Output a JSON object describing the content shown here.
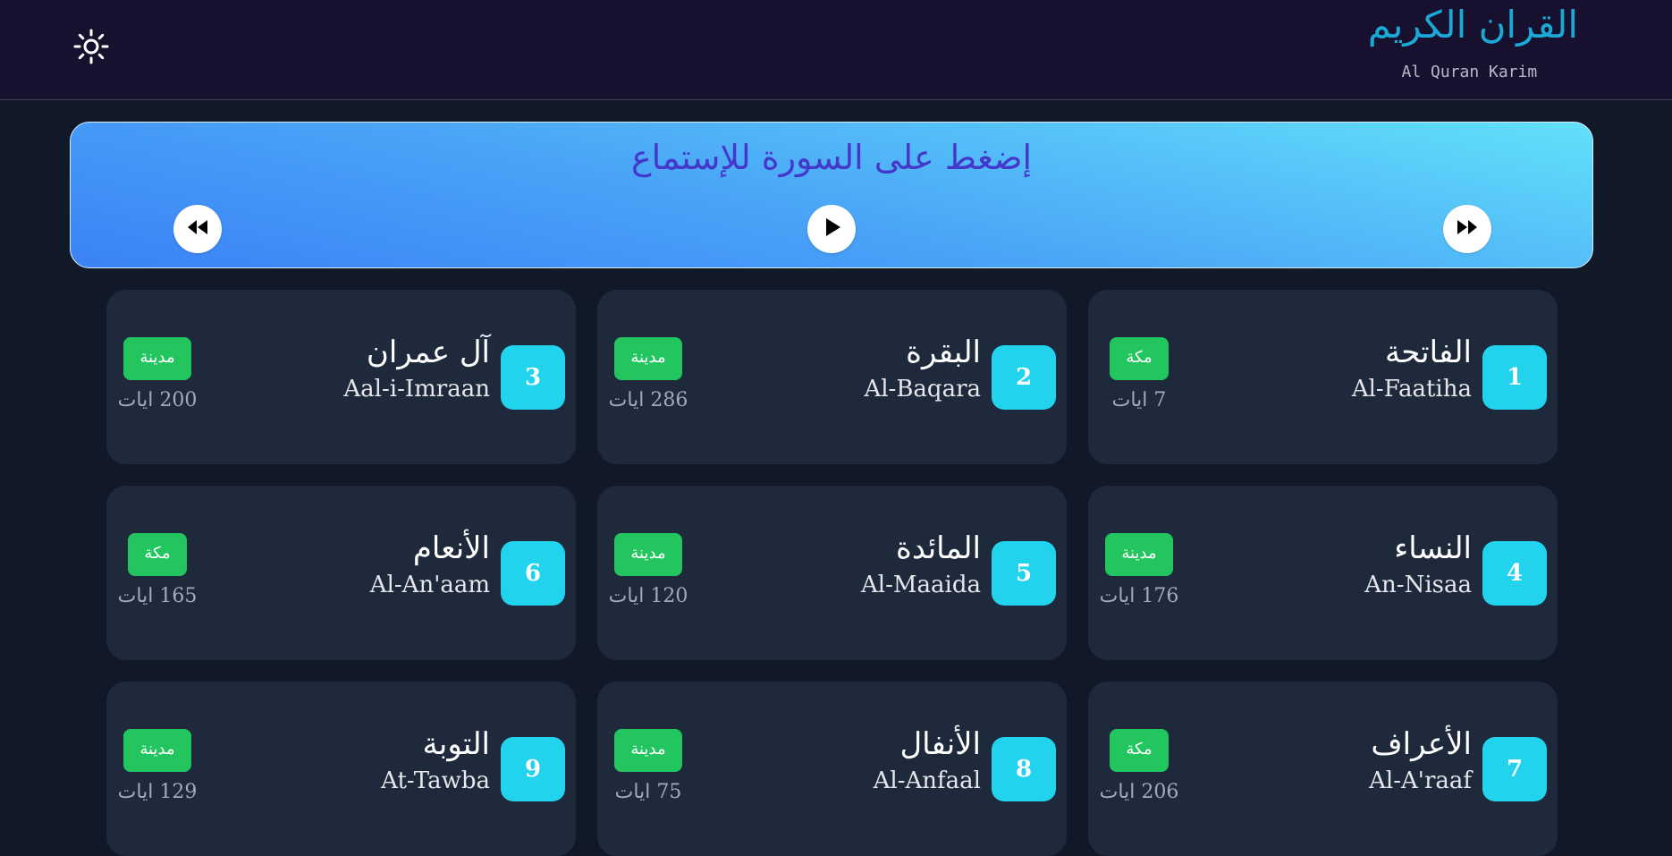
{
  "header": {
    "title": "القران الكريم",
    "subtitle": "Al Quran Karim",
    "theme_icon": "sun-icon"
  },
  "player": {
    "prompt": "إضغط على السورة للإستماع",
    "controls": [
      "rewind-icon",
      "play-icon",
      "fast-forward-icon"
    ]
  },
  "surahs": [
    {
      "number": "1",
      "arabic": "الفاتحة",
      "english": "Al-Faatiha",
      "type": "مكة",
      "ayat": "7 ايات"
    },
    {
      "number": "2",
      "arabic": "البقرة",
      "english": "Al-Baqara",
      "type": "مدينة",
      "ayat": "286 ايات"
    },
    {
      "number": "3",
      "arabic": "آل عمران",
      "english": "Aal-i-Imraan",
      "type": "مدينة",
      "ayat": "200 ايات"
    },
    {
      "number": "4",
      "arabic": "النساء",
      "english": "An-Nisaa",
      "type": "مدينة",
      "ayat": "176 ايات"
    },
    {
      "number": "5",
      "arabic": "المائدة",
      "english": "Al-Maaida",
      "type": "مدينة",
      "ayat": "120 ايات"
    },
    {
      "number": "6",
      "arabic": "الأنعام",
      "english": "Al-An'aam",
      "type": "مكة",
      "ayat": "165 ايات"
    },
    {
      "number": "7",
      "arabic": "الأعراف",
      "english": "Al-A'raaf",
      "type": "مكة",
      "ayat": "206 ايات"
    },
    {
      "number": "8",
      "arabic": "الأنفال",
      "english": "Al-Anfaal",
      "type": "مدينة",
      "ayat": "75 ايات"
    },
    {
      "number": "9",
      "arabic": "التوبة",
      "english": "At-Tawba",
      "type": "مدينة",
      "ayat": "129 ايات"
    }
  ],
  "colors": {
    "header_bg": "#17112f",
    "page_bg": "#111827",
    "card_bg": "#1e293b",
    "number_bg": "#22d3ee",
    "badge_bg": "#22c55e",
    "title_color": "#1ba9d6",
    "prompt_color": "#4338ca"
  }
}
